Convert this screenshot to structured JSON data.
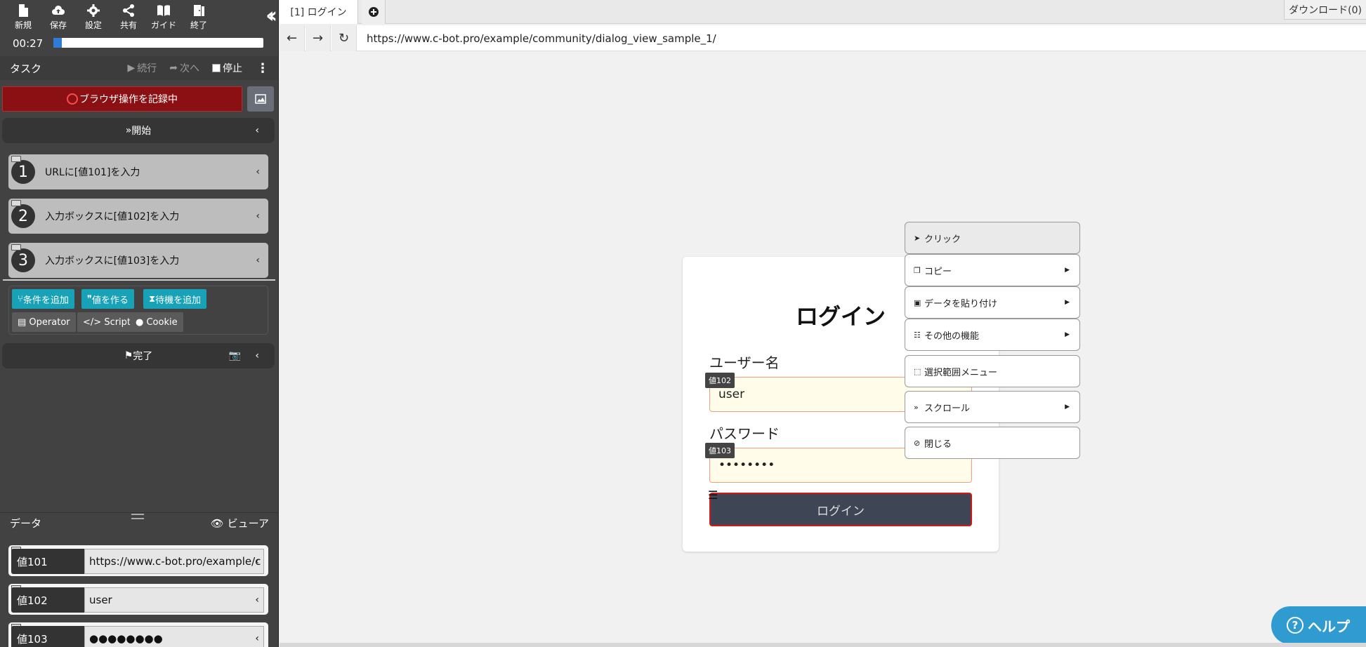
{
  "toolbar": {
    "items": [
      {
        "label": "新規",
        "icon": "new-file-icon"
      },
      {
        "label": "保存",
        "icon": "cloud-upload-icon"
      },
      {
        "label": "設定",
        "icon": "gear-icon"
      },
      {
        "label": "共有",
        "icon": "share-icon"
      },
      {
        "label": "ガイド",
        "icon": "book-icon"
      },
      {
        "label": "終了",
        "icon": "exit-icon"
      }
    ],
    "collapse_icon": "double-chevron-left-icon"
  },
  "timer": "00:27",
  "progress": 0.04,
  "task": {
    "title": "タスク",
    "continue_label": "続行",
    "next_label": "次へ",
    "stop_label": "停止",
    "stop_checked": false
  },
  "record_button": "ブラウザ操作を記録中",
  "start_label": "開始",
  "steps": [
    {
      "num": "1",
      "label": "URLに[値101]を入力"
    },
    {
      "num": "2",
      "label": "入力ボックスに[値102]を入力"
    },
    {
      "num": "3",
      "label": "入力ボックスに[値103]を入力"
    }
  ],
  "actions": {
    "add_condition": "条件を追加",
    "make_value": "値を作る",
    "add_wait": "待機を追加",
    "operator": "Operator",
    "script": "Script",
    "cookie": "Cookie"
  },
  "done_label": "完了",
  "data_panel": {
    "title": "データ",
    "viewer_label": "ビューア",
    "rows": [
      {
        "name": "値101",
        "value": "https://www.c-bot.pro/example/c"
      },
      {
        "name": "値102",
        "value": "user"
      },
      {
        "name": "値103",
        "value": "●●●●●●●●"
      }
    ]
  },
  "browser": {
    "tab_label": "[1] ログイン",
    "download_label": "ダウンロード(0)",
    "url": "https://www.c-bot.pro/example/community/dialog_view_sample_1/"
  },
  "login": {
    "title": "ログイン",
    "username_label": "ユーザー名",
    "username_value": "user",
    "username_tag": "値102",
    "password_label": "パスワード",
    "password_value": "••••••••",
    "password_tag": "値103",
    "button_label": "ログイン"
  },
  "context_menu": [
    {
      "label": "クリック",
      "icon": "pointer-icon",
      "submenu": false
    },
    {
      "label": "コピー",
      "icon": "copy-icon",
      "submenu": true
    },
    {
      "label": "データを貼り付け",
      "icon": "paste-icon",
      "submenu": true
    },
    {
      "label": "その他の機能",
      "icon": "more-functions-icon",
      "submenu": true
    },
    {
      "label": "選択範囲メニュー",
      "icon": "selection-icon",
      "submenu": false
    },
    {
      "label": "スクロール",
      "icon": "scroll-icon",
      "submenu": true
    },
    {
      "label": "閉じる",
      "icon": "ban-icon",
      "submenu": false
    }
  ],
  "help_label": "ヘルプ",
  "colors": {
    "record_bg": "#8b1014",
    "action_teal": "#17a2b8",
    "progress": "#2f7bd6",
    "help": "#2f9bd1"
  }
}
